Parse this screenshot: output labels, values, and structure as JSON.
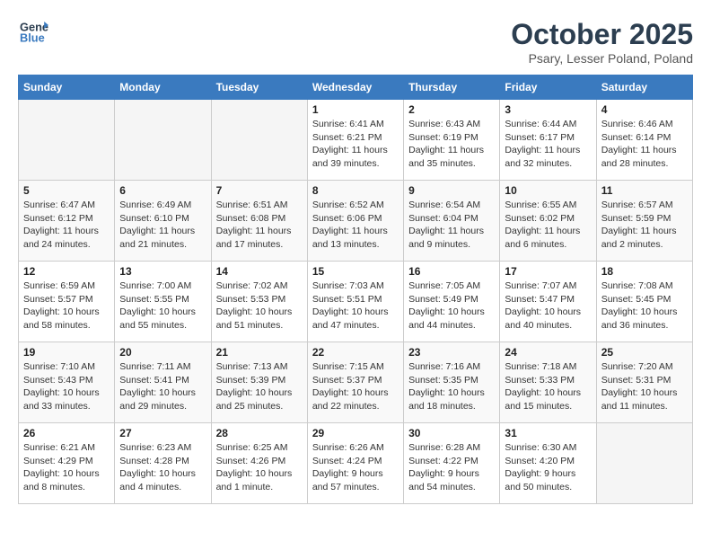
{
  "header": {
    "logo_line1": "General",
    "logo_line2": "Blue",
    "month_title": "October 2025",
    "location": "Psary, Lesser Poland, Poland"
  },
  "weekdays": [
    "Sunday",
    "Monday",
    "Tuesday",
    "Wednesday",
    "Thursday",
    "Friday",
    "Saturday"
  ],
  "weeks": [
    [
      {
        "day": "",
        "info": ""
      },
      {
        "day": "",
        "info": ""
      },
      {
        "day": "",
        "info": ""
      },
      {
        "day": "1",
        "info": "Sunrise: 6:41 AM\nSunset: 6:21 PM\nDaylight: 11 hours\nand 39 minutes."
      },
      {
        "day": "2",
        "info": "Sunrise: 6:43 AM\nSunset: 6:19 PM\nDaylight: 11 hours\nand 35 minutes."
      },
      {
        "day": "3",
        "info": "Sunrise: 6:44 AM\nSunset: 6:17 PM\nDaylight: 11 hours\nand 32 minutes."
      },
      {
        "day": "4",
        "info": "Sunrise: 6:46 AM\nSunset: 6:14 PM\nDaylight: 11 hours\nand 28 minutes."
      }
    ],
    [
      {
        "day": "5",
        "info": "Sunrise: 6:47 AM\nSunset: 6:12 PM\nDaylight: 11 hours\nand 24 minutes."
      },
      {
        "day": "6",
        "info": "Sunrise: 6:49 AM\nSunset: 6:10 PM\nDaylight: 11 hours\nand 21 minutes."
      },
      {
        "day": "7",
        "info": "Sunrise: 6:51 AM\nSunset: 6:08 PM\nDaylight: 11 hours\nand 17 minutes."
      },
      {
        "day": "8",
        "info": "Sunrise: 6:52 AM\nSunset: 6:06 PM\nDaylight: 11 hours\nand 13 minutes."
      },
      {
        "day": "9",
        "info": "Sunrise: 6:54 AM\nSunset: 6:04 PM\nDaylight: 11 hours\nand 9 minutes."
      },
      {
        "day": "10",
        "info": "Sunrise: 6:55 AM\nSunset: 6:02 PM\nDaylight: 11 hours\nand 6 minutes."
      },
      {
        "day": "11",
        "info": "Sunrise: 6:57 AM\nSunset: 5:59 PM\nDaylight: 11 hours\nand 2 minutes."
      }
    ],
    [
      {
        "day": "12",
        "info": "Sunrise: 6:59 AM\nSunset: 5:57 PM\nDaylight: 10 hours\nand 58 minutes."
      },
      {
        "day": "13",
        "info": "Sunrise: 7:00 AM\nSunset: 5:55 PM\nDaylight: 10 hours\nand 55 minutes."
      },
      {
        "day": "14",
        "info": "Sunrise: 7:02 AM\nSunset: 5:53 PM\nDaylight: 10 hours\nand 51 minutes."
      },
      {
        "day": "15",
        "info": "Sunrise: 7:03 AM\nSunset: 5:51 PM\nDaylight: 10 hours\nand 47 minutes."
      },
      {
        "day": "16",
        "info": "Sunrise: 7:05 AM\nSunset: 5:49 PM\nDaylight: 10 hours\nand 44 minutes."
      },
      {
        "day": "17",
        "info": "Sunrise: 7:07 AM\nSunset: 5:47 PM\nDaylight: 10 hours\nand 40 minutes."
      },
      {
        "day": "18",
        "info": "Sunrise: 7:08 AM\nSunset: 5:45 PM\nDaylight: 10 hours\nand 36 minutes."
      }
    ],
    [
      {
        "day": "19",
        "info": "Sunrise: 7:10 AM\nSunset: 5:43 PM\nDaylight: 10 hours\nand 33 minutes."
      },
      {
        "day": "20",
        "info": "Sunrise: 7:11 AM\nSunset: 5:41 PM\nDaylight: 10 hours\nand 29 minutes."
      },
      {
        "day": "21",
        "info": "Sunrise: 7:13 AM\nSunset: 5:39 PM\nDaylight: 10 hours\nand 25 minutes."
      },
      {
        "day": "22",
        "info": "Sunrise: 7:15 AM\nSunset: 5:37 PM\nDaylight: 10 hours\nand 22 minutes."
      },
      {
        "day": "23",
        "info": "Sunrise: 7:16 AM\nSunset: 5:35 PM\nDaylight: 10 hours\nand 18 minutes."
      },
      {
        "day": "24",
        "info": "Sunrise: 7:18 AM\nSunset: 5:33 PM\nDaylight: 10 hours\nand 15 minutes."
      },
      {
        "day": "25",
        "info": "Sunrise: 7:20 AM\nSunset: 5:31 PM\nDaylight: 10 hours\nand 11 minutes."
      }
    ],
    [
      {
        "day": "26",
        "info": "Sunrise: 6:21 AM\nSunset: 4:29 PM\nDaylight: 10 hours\nand 8 minutes."
      },
      {
        "day": "27",
        "info": "Sunrise: 6:23 AM\nSunset: 4:28 PM\nDaylight: 10 hours\nand 4 minutes."
      },
      {
        "day": "28",
        "info": "Sunrise: 6:25 AM\nSunset: 4:26 PM\nDaylight: 10 hours\nand 1 minute."
      },
      {
        "day": "29",
        "info": "Sunrise: 6:26 AM\nSunset: 4:24 PM\nDaylight: 9 hours\nand 57 minutes."
      },
      {
        "day": "30",
        "info": "Sunrise: 6:28 AM\nSunset: 4:22 PM\nDaylight: 9 hours\nand 54 minutes."
      },
      {
        "day": "31",
        "info": "Sunrise: 6:30 AM\nSunset: 4:20 PM\nDaylight: 9 hours\nand 50 minutes."
      },
      {
        "day": "",
        "info": ""
      }
    ]
  ]
}
